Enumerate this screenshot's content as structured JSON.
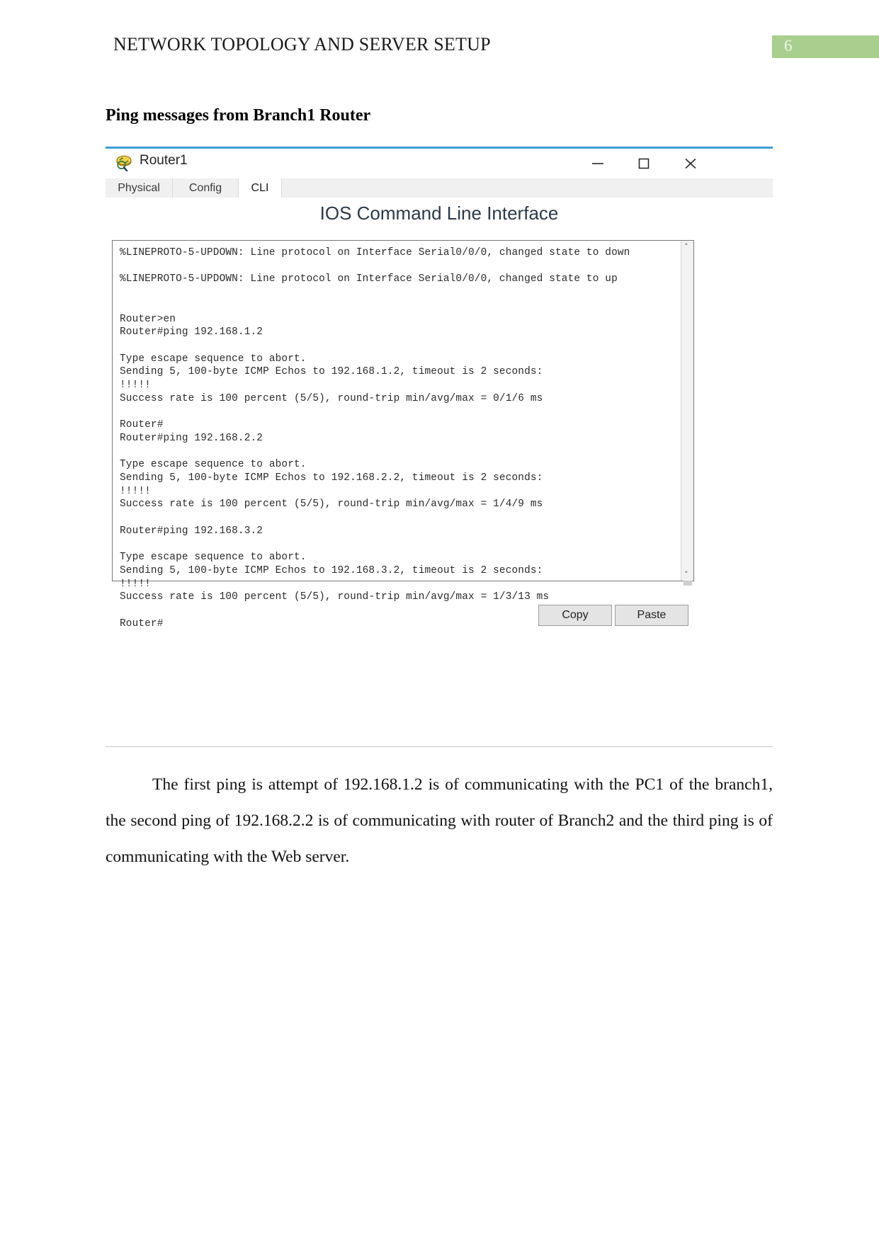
{
  "document": {
    "header_title": "NETWORK TOPOLOGY AND SERVER SETUP",
    "page_number": "6",
    "page_badge_color": "#a8cf8e",
    "section_heading": "Ping messages from Branch1 Router",
    "paragraph": "The first ping is attempt of 192.168.1.2 is of communicating with the PC1 of the branch1, the second ping of 192.168.2.2 is of communicating with router of Branch2 and the third ping is of communicating with the Web server."
  },
  "window": {
    "title": "Router1",
    "accent_color": "#3d9fd6",
    "app_icon": "router-icon",
    "controls": {
      "minimize": "minimize-icon",
      "maximize": "maximize-icon",
      "close": "close-icon"
    },
    "tabs": [
      {
        "label": "Physical",
        "active": false
      },
      {
        "label": "Config",
        "active": false
      },
      {
        "label": "CLI",
        "active": true
      }
    ],
    "panel_heading": "IOS Command Line Interface",
    "terminal_text": "%LINEPROTO-5-UPDOWN: Line protocol on Interface Serial0/0/0, changed state to down\n\n%LINEPROTO-5-UPDOWN: Line protocol on Interface Serial0/0/0, changed state to up\n\n\nRouter>en\nRouter#ping 192.168.1.2\n\nType escape sequence to abort.\nSending 5, 100-byte ICMP Echos to 192.168.1.2, timeout is 2 seconds:\n!!!!!\nSuccess rate is 100 percent (5/5), round-trip min/avg/max = 0/1/6 ms\n\nRouter#\nRouter#ping 192.168.2.2\n\nType escape sequence to abort.\nSending 5, 100-byte ICMP Echos to 192.168.2.2, timeout is 2 seconds:\n!!!!!\nSuccess rate is 100 percent (5/5), round-trip min/avg/max = 1/4/9 ms\n\nRouter#ping 192.168.3.2\n\nType escape sequence to abort.\nSending 5, 100-byte ICMP Echos to 192.168.3.2, timeout is 2 seconds:\n!!!!!\nSuccess rate is 100 percent (5/5), round-trip min/avg/max = 1/3/13 ms\n\nRouter#",
    "scrollbar": {
      "up_arrow": "˄",
      "down_arrow": "˅"
    },
    "buttons": {
      "copy": "Copy",
      "paste": "Paste"
    }
  }
}
